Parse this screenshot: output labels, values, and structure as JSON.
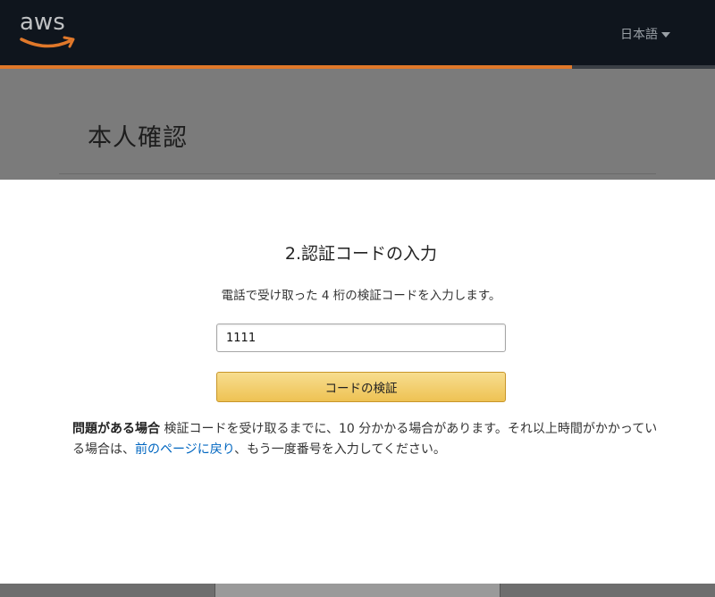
{
  "header": {
    "logo_text": "aws",
    "language": "日本語"
  },
  "page": {
    "title": "本人確認"
  },
  "modal": {
    "heading": "2.認証コードの入力",
    "description": "電話で受け取った 4 桁の検証コードを入力します。",
    "code_input_value": "1111",
    "verify_button_label": "コードの検証",
    "help_label": "問題がある場合",
    "help_text_1": " 検証コードを受け取るまでに、10 分かかる場合があります。それ以上時間がかかっている場合は、",
    "help_link": "前のページに戻り",
    "help_text_2": "、もう一度番号を入力してください。"
  },
  "colors": {
    "header_bg": "#0f151d",
    "accent_orange": "#e0782a",
    "button_yellow": "#eec253",
    "link_blue": "#0066c0"
  }
}
